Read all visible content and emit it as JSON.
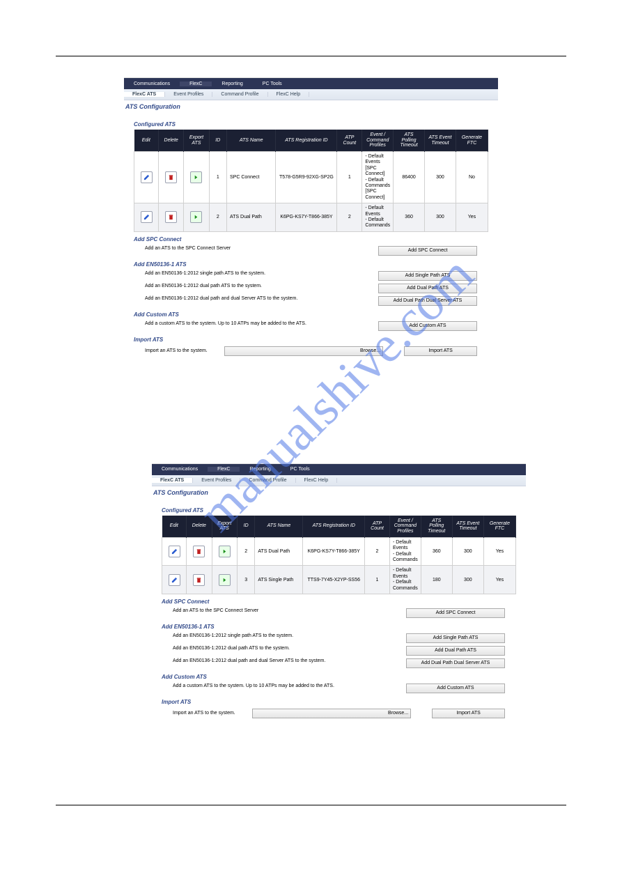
{
  "watermark": "manualshive.com",
  "nav1": {
    "communications": "Communications",
    "flexc": "FlexC",
    "reporting": "Reporting",
    "pctools": "PC Tools"
  },
  "nav2": {
    "flexc_ats": "FlexC ATS",
    "event_profiles": "Event Profiles",
    "command_profile": "Command Profile",
    "flexc_help": "FlexC Help"
  },
  "page_title": "ATS Configuration",
  "sections": {
    "configured": "Configured ATS",
    "spc": "Add SPC Connect",
    "en": "Add EN50136-1 ATS",
    "custom": "Add Custom ATS",
    "import": "Import ATS"
  },
  "headers": {
    "edit": "Edit",
    "del": "Delete",
    "exp": "Export ATS",
    "id": "ID",
    "name": "ATS Name",
    "reg": "ATS Registration ID",
    "count": "ATP Count",
    "profiles": "Event / Command Profiles",
    "poll": "ATS Polling Timeout",
    "evtto": "ATS Event Timeout",
    "ftc": "Generate FTC"
  },
  "shot1_rows": [
    {
      "id": "1",
      "name": "SPC Connect",
      "reg": "T578-G5R9-92XG-SP2G",
      "count": "1",
      "p1": "- Default Events [SPC Connect]",
      "p2": "- Default Commands [SPC Connect]",
      "poll": "86400",
      "evtto": "300",
      "ftc": "No"
    },
    {
      "id": "2",
      "name": "ATS Dual Path",
      "reg": "K6PG-KS7Y-T866-385Y",
      "count": "2",
      "p1": "- Default Events",
      "p2": "- Default Commands",
      "poll": "360",
      "evtto": "300",
      "ftc": "Yes"
    }
  ],
  "shot2_rows": [
    {
      "id": "2",
      "name": "ATS Dual Path",
      "reg": "K6PG-KS7Y-T866-385Y",
      "count": "2",
      "p1": "- Default Events",
      "p2": "- Default Commands",
      "poll": "360",
      "evtto": "300",
      "ftc": "Yes"
    },
    {
      "id": "3",
      "name": "ATS Single Path",
      "reg": "TTS9-7Y45-X2YP-SS56",
      "count": "1",
      "p1": "- Default Events",
      "p2": "- Default Commands",
      "poll": "180",
      "evtto": "300",
      "ftc": "Yes"
    }
  ],
  "text": {
    "spc_desc": "Add an ATS to the SPC Connect Server",
    "en_single": "Add an EN50136-1:2012 single path ATS to the system.",
    "en_dual": "Add an EN50136-1:2012 dual path ATS to the system.",
    "en_dual_server": "Add an EN50136-1:2012 dual path and dual Server ATS to the system.",
    "custom_desc": "Add a custom ATS to the system. Up to 10 ATPs may be added to the ATS.",
    "import_desc": "Import an ATS to the system.",
    "browse": "Browse..."
  },
  "buttons": {
    "add_spc": "Add SPC Connect",
    "add_single": "Add Single Path ATS",
    "add_dual": "Add Dual Path ATS",
    "add_dual_server": "Add Dual Path Dual Server ATS",
    "add_custom": "Add Custom ATS",
    "import": "Import ATS"
  }
}
